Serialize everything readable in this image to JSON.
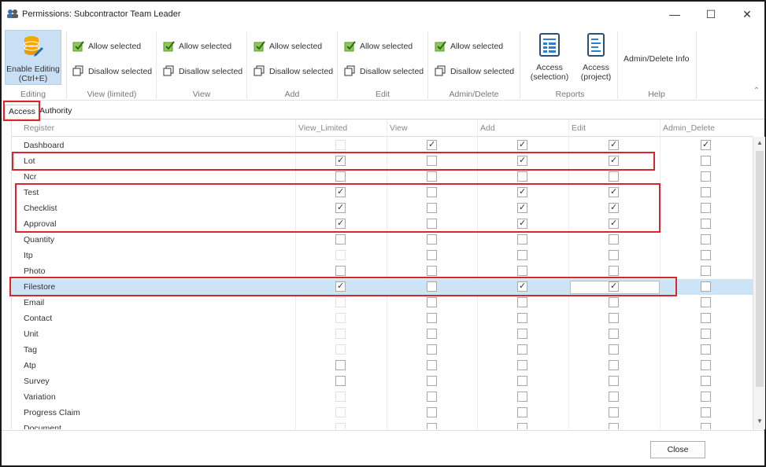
{
  "window": {
    "title": "Permissions: Subcontractor Team Leader",
    "minimize": "—",
    "maximize": "☐",
    "close": "✕"
  },
  "ribbon": {
    "enable_editing": {
      "label": "Enable Editing\n(Ctrl+E)",
      "icon": "database-pencil-icon"
    },
    "groups": [
      {
        "label": "Editing"
      },
      {
        "label": "View (limited)",
        "allow": "Allow selected",
        "disallow": "Disallow selected"
      },
      {
        "label": "View",
        "allow": "Allow selected",
        "disallow": "Disallow selected"
      },
      {
        "label": "Add",
        "allow": "Allow selected",
        "disallow": "Disallow selected"
      },
      {
        "label": "Edit",
        "allow": "Allow selected",
        "disallow": "Disallow selected"
      },
      {
        "label": "Admin/Delete",
        "allow": "Allow selected",
        "disallow": "Disallow selected"
      },
      {
        "label": "Reports"
      },
      {
        "label": "Help"
      }
    ],
    "reports": [
      {
        "label": "Access\n(selection)",
        "icon": "report-selection-icon"
      },
      {
        "label": "Access\n(project)",
        "icon": "report-project-icon"
      }
    ],
    "help_item": "Admin/Delete Info",
    "collapse": "⌃"
  },
  "tabs": [
    {
      "label": "Access",
      "active": true
    },
    {
      "label": "Authority",
      "active": false
    }
  ],
  "grid": {
    "columns": [
      "Register",
      "View_Limited",
      "View",
      "Add",
      "Edit",
      "Admin_Delete"
    ],
    "rows": [
      {
        "name": "Dashboard",
        "v": [
          0,
          1,
          1,
          1,
          1
        ],
        "dis": [
          1,
          0,
          0,
          0,
          0
        ]
      },
      {
        "name": "Lot",
        "v": [
          1,
          0,
          1,
          1,
          0
        ],
        "dis": [
          0,
          0,
          0,
          0,
          0
        ]
      },
      {
        "name": "Ncr",
        "v": [
          0,
          0,
          0,
          0,
          0
        ],
        "dis": [
          0,
          0,
          0,
          0,
          0
        ]
      },
      {
        "name": "Test",
        "v": [
          1,
          0,
          1,
          1,
          0
        ],
        "dis": [
          0,
          0,
          0,
          0,
          0
        ]
      },
      {
        "name": "Checklist",
        "v": [
          1,
          0,
          1,
          1,
          0
        ],
        "dis": [
          0,
          0,
          0,
          0,
          0
        ]
      },
      {
        "name": "Approval",
        "v": [
          1,
          0,
          1,
          1,
          0
        ],
        "dis": [
          0,
          0,
          0,
          0,
          0
        ]
      },
      {
        "name": "Quantity",
        "v": [
          0,
          0,
          0,
          0,
          0
        ],
        "dis": [
          0,
          0,
          0,
          0,
          0
        ]
      },
      {
        "name": "Itp",
        "v": [
          0,
          0,
          0,
          0,
          0
        ],
        "dis": [
          1,
          0,
          0,
          0,
          0
        ]
      },
      {
        "name": "Photo",
        "v": [
          0,
          0,
          0,
          0,
          0
        ],
        "dis": [
          0,
          0,
          0,
          0,
          0
        ]
      },
      {
        "name": "Filestore",
        "v": [
          1,
          0,
          1,
          1,
          0
        ],
        "dis": [
          0,
          0,
          0,
          0,
          0
        ],
        "selected": true
      },
      {
        "name": "Email",
        "v": [
          0,
          0,
          0,
          0,
          0
        ],
        "dis": [
          1,
          0,
          0,
          0,
          0
        ]
      },
      {
        "name": "Contact",
        "v": [
          0,
          0,
          0,
          0,
          0
        ],
        "dis": [
          1,
          0,
          0,
          0,
          0
        ]
      },
      {
        "name": "Unit",
        "v": [
          0,
          0,
          0,
          0,
          0
        ],
        "dis": [
          1,
          0,
          0,
          0,
          0
        ]
      },
      {
        "name": "Tag",
        "v": [
          0,
          0,
          0,
          0,
          0
        ],
        "dis": [
          1,
          0,
          0,
          0,
          0
        ]
      },
      {
        "name": "Atp",
        "v": [
          0,
          0,
          0,
          0,
          0
        ],
        "dis": [
          0,
          0,
          0,
          0,
          0
        ]
      },
      {
        "name": "Survey",
        "v": [
          0,
          0,
          0,
          0,
          0
        ],
        "dis": [
          0,
          0,
          0,
          0,
          0
        ]
      },
      {
        "name": "Variation",
        "v": [
          0,
          0,
          0,
          0,
          0
        ],
        "dis": [
          1,
          0,
          0,
          0,
          0
        ]
      },
      {
        "name": "Progress Claim",
        "v": [
          0,
          0,
          0,
          0,
          0
        ],
        "dis": [
          1,
          0,
          0,
          0,
          0
        ]
      },
      {
        "name": "Document",
        "v": [
          0,
          0,
          0,
          0,
          0
        ],
        "dis": [
          1,
          0,
          0,
          0,
          0
        ]
      }
    ]
  },
  "scroll": {
    "up": "▲",
    "down": "▼"
  },
  "footer": {
    "close_label": "Close"
  },
  "colors": {
    "highlight": "#d7262d",
    "selected_row": "#cde3f6",
    "accent": "#3c8fd8"
  }
}
